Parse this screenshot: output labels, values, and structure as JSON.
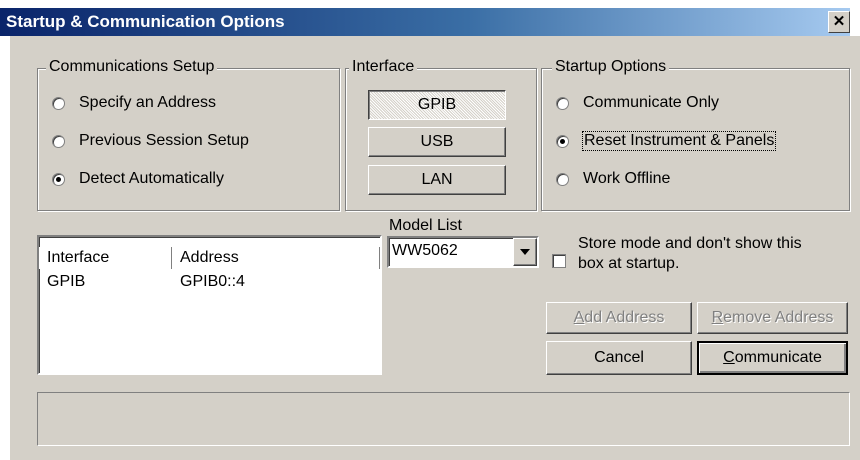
{
  "window": {
    "title": "Startup & Communication Options",
    "close_glyph": "✕"
  },
  "communications_setup": {
    "legend": "Communications Setup",
    "options": [
      {
        "label": "Specify an Address",
        "checked": false
      },
      {
        "label": "Previous Session Setup",
        "checked": false
      },
      {
        "label": "Detect Automatically",
        "checked": true
      }
    ]
  },
  "interface": {
    "legend": "Interface",
    "buttons": [
      {
        "label": "GPIB",
        "pressed": true
      },
      {
        "label": "USB",
        "pressed": false
      },
      {
        "label": "LAN",
        "pressed": false
      }
    ]
  },
  "startup_options": {
    "legend": "Startup Options",
    "options": [
      {
        "label": "Communicate Only",
        "checked": false
      },
      {
        "label": "Reset Instrument & Panels",
        "checked": true
      },
      {
        "label": "Work Offline",
        "checked": false
      }
    ]
  },
  "address_list": {
    "columns": [
      "Interface",
      "Address"
    ],
    "rows": [
      {
        "interface": "GPIB",
        "address": "GPIB0::4"
      }
    ]
  },
  "model_list": {
    "label": "Model List",
    "value": "WW5062"
  },
  "store_mode": {
    "label_line1": "Store mode and don't show this",
    "label_line2": "box at startup.",
    "checked": false
  },
  "buttons": {
    "add_address": {
      "accel": "A",
      "rest": "dd Address",
      "enabled": false
    },
    "remove_address": {
      "accel": "R",
      "rest": "emove Address",
      "enabled": false
    },
    "cancel": {
      "label": "Cancel"
    },
    "communicate": {
      "accel": "C",
      "rest": "ommunicate",
      "default": true
    }
  },
  "status_bar": {
    "text": ""
  },
  "icons": {
    "dropdown": "dropdown-arrow-icon"
  }
}
